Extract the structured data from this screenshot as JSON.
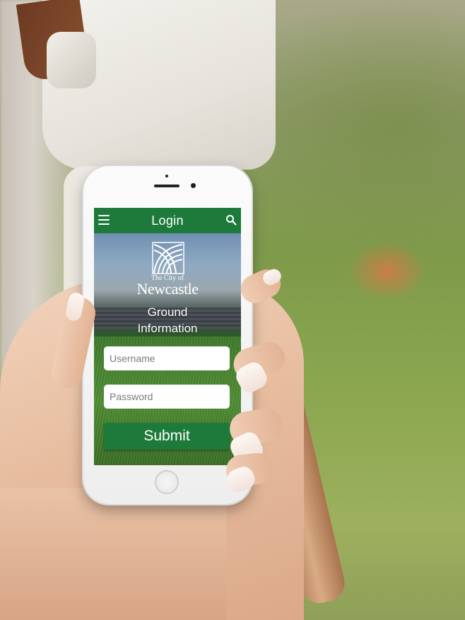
{
  "app": {
    "title": "Login",
    "accent_color": "#1d7a3a",
    "icons": {
      "menu": "hamburger-icon",
      "search": "search-icon"
    }
  },
  "branding": {
    "city_prefix": "The City of",
    "city_name": "Newcastle",
    "logo_icon": "newcastle-logo-icon"
  },
  "hero": {
    "line1": "Ground",
    "line2": "Information"
  },
  "form": {
    "username_placeholder": "Username",
    "password_placeholder": "Password",
    "submit_label": "Submit"
  }
}
